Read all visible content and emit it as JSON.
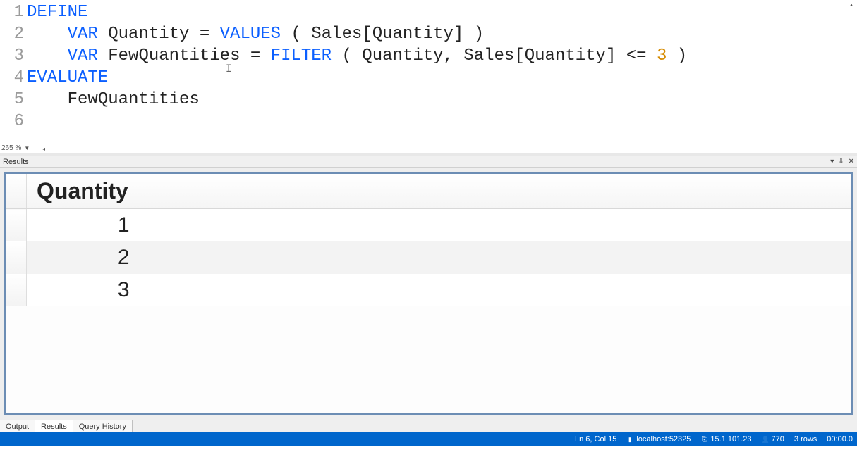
{
  "editor": {
    "zoom_label": "265 %",
    "lines": [
      [
        {
          "t": "DEFINE",
          "c": "kw-blue"
        }
      ],
      [
        {
          "t": "    "
        },
        {
          "t": "VAR",
          "c": "kw-blue"
        },
        {
          "t": " Quantity = "
        },
        {
          "t": "VALUES",
          "c": "kw-func"
        },
        {
          "t": " ( Sales[Quantity] )"
        }
      ],
      [
        {
          "t": "    "
        },
        {
          "t": "VAR",
          "c": "kw-blue"
        },
        {
          "t": " FewQuantities = "
        },
        {
          "t": "FILTER",
          "c": "kw-func"
        },
        {
          "t": " ( Quantity, Sales[Quantity] <= "
        },
        {
          "t": "3",
          "c": "num"
        },
        {
          "t": " )"
        }
      ],
      [
        {
          "t": ""
        }
      ],
      [
        {
          "t": "EVALUATE",
          "c": "kw-blue"
        }
      ],
      [
        {
          "t": "    FewQuantities"
        }
      ]
    ]
  },
  "results_panel": {
    "title": "Results",
    "column_header": "Quantity",
    "rows": [
      1,
      2,
      3
    ]
  },
  "bottom_tabs": {
    "items": [
      "Output",
      "Results",
      "Query History"
    ],
    "active_index": 1
  },
  "status": {
    "cursor": "Ln 6, Col 15",
    "server": "localhost:52325",
    "version": "15.1.101.23",
    "user": "770",
    "rowcount": "3 rows",
    "elapsed": "00:00.0"
  }
}
